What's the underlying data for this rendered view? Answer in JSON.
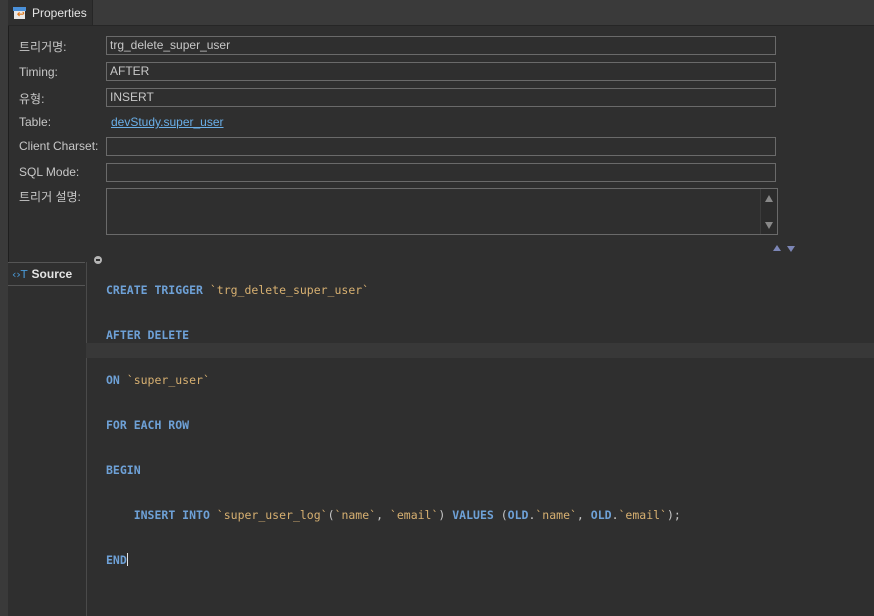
{
  "tab": {
    "label": "Properties",
    "icon": "properties-icon"
  },
  "form": {
    "trigger_name_label": "트리거명:",
    "trigger_name_value": "trg_delete_super_user",
    "timing_label": "Timing:",
    "timing_value": "AFTER",
    "type_label": "유형:",
    "type_value": "INSERT",
    "table_label": "Table:",
    "table_value": "devStudy.super_user",
    "client_charset_label": "Client Charset:",
    "client_charset_value": "",
    "sql_mode_label": "SQL Mode:",
    "sql_mode_value": "",
    "description_label": "트리거 설명:",
    "description_value": ""
  },
  "side_tab": {
    "label": "Source",
    "icon": "source-icon"
  },
  "code": {
    "line1": {
      "kw": "CREATE TRIGGER ",
      "id": "`trg_delete_super_user`"
    },
    "line2": {
      "kw": "AFTER DELETE"
    },
    "line3": {
      "kw": "ON ",
      "id": "`super_user`"
    },
    "line4": {
      "kw": "FOR EACH ROW"
    },
    "line5": {
      "kw": "BEGIN"
    },
    "line6": {
      "indent": "    ",
      "kw1": "INSERT INTO ",
      "id1": "`super_user_log`",
      "p1": "(",
      "id2": "`name`",
      "p2": ", ",
      "id3": "`email`",
      "p3": ") ",
      "kw2": "VALUES",
      "p4": " (",
      "kw3": "OLD",
      "p5": ".",
      "id4": "`name`",
      "p6": ", ",
      "kw4": "OLD",
      "p7": ".",
      "id5": "`email`",
      "p8": ");"
    },
    "line7": {
      "kw": "END"
    }
  },
  "colors": {
    "keyword": "#6ea1d7",
    "identifier": "#d7b071",
    "link": "#6aafe8",
    "background": "#2f2f2f"
  }
}
